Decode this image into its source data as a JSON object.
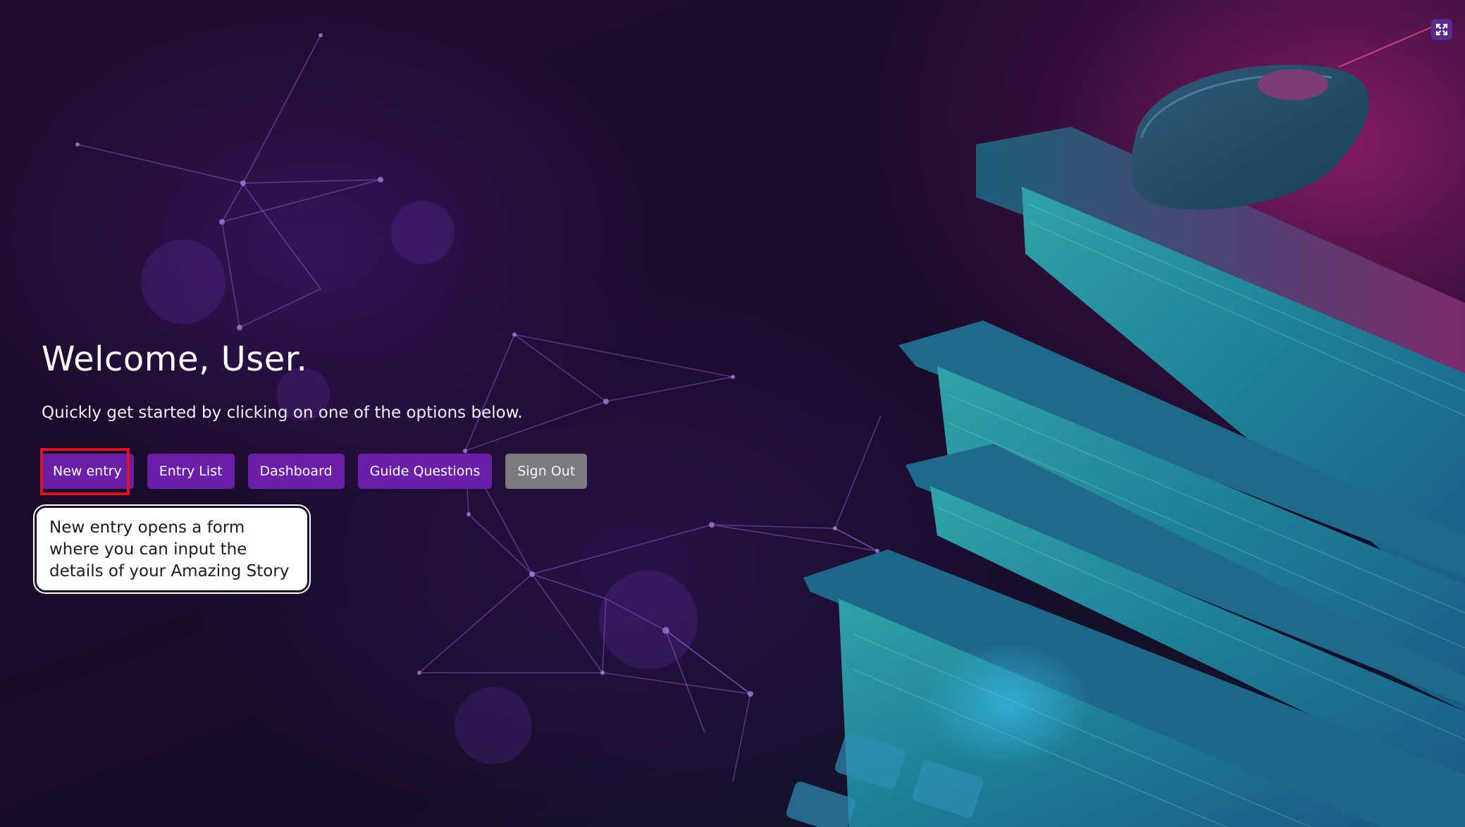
{
  "hero": {
    "title": "Welcome, User.",
    "subtitle": "Quickly get started by clicking on one of the options below."
  },
  "actions": {
    "new_entry": "New entry",
    "entry_list": "Entry List",
    "dashboard": "Dashboard",
    "guide_questions": "Guide Questions",
    "sign_out": "Sign Out"
  },
  "tooltip": {
    "text": "New entry opens a form where you can input the details of your Amazing Story"
  },
  "icons": {
    "corner": "expand-icon"
  },
  "colors": {
    "primary_button": "#6a1fa8",
    "secondary_button": "#7a7a7f",
    "highlight": "#e0121e"
  }
}
